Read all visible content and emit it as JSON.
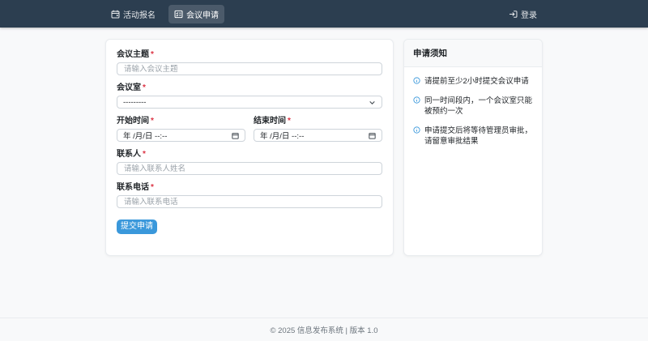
{
  "colors": {
    "navbar_bg": "#2c3e50",
    "accent_blue": "#3a98db",
    "required_red": "#dc3545",
    "page_bg": "#f8f9fa",
    "muted_text": "#6c757d"
  },
  "navbar": {
    "items": [
      {
        "label": "活动报名",
        "icon": "calendar-event-icon",
        "active": false
      },
      {
        "label": "会议申请",
        "icon": "card-checklist-icon",
        "active": true
      }
    ],
    "login": {
      "label": "登录",
      "icon": "login-arrow-icon"
    }
  },
  "form": {
    "required_marker": "*",
    "subject_label": "会议主题",
    "subject_placeholder": "请输入会议主题",
    "room_label": "会议室",
    "room_value": "---------",
    "start_label": "开始时间",
    "end_label": "结束时间",
    "datetime_value": "年 /月/日 --:--",
    "contact_label": "联系人",
    "contact_placeholder": "请输入联系人姓名",
    "phone_label": "联系电话",
    "phone_placeholder": "请输入联系电话",
    "submit_label": "提交申请"
  },
  "notice": {
    "title": "申请须知",
    "items": [
      "请提前至少2小时提交会议申请",
      "同一时间段内，一个会议室只能被预约一次",
      "申请提交后将等待管理员审批，请留意审批结果"
    ]
  },
  "footer": {
    "text": "© 2025 信息发布系统 | 版本 1.0"
  }
}
